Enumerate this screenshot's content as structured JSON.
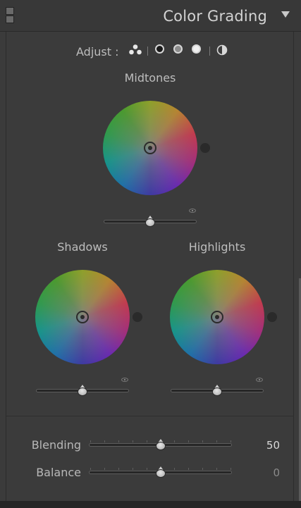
{
  "panel": {
    "title": "Color Grading",
    "icons": [
      "collapse-square-icon",
      "panel-menu-triangle-icon"
    ]
  },
  "adjust": {
    "label": "Adjust :",
    "modes": [
      "three-way",
      "shadows",
      "midtones",
      "highlights",
      "global"
    ],
    "selected": "three-way",
    "colors": {
      "shadows": "#1a1a1a",
      "midtones": "#8c8c8c",
      "highlights": "#f0f0f0"
    }
  },
  "wheels": {
    "midtones": {
      "label": "Midtones",
      "luminance": 0.5
    },
    "shadows": {
      "label": "Shadows",
      "luminance": 0.5
    },
    "highlights": {
      "label": "Highlights",
      "luminance": 0.5
    }
  },
  "blending": {
    "label": "Blending",
    "value": "50",
    "value_color": "#d8d8d8",
    "position": 0.5
  },
  "balance": {
    "label": "Balance",
    "value": "0",
    "value_color": "#8a8a8a",
    "position": 0.5
  },
  "colors": {
    "panel_bg": "#3b3b3b",
    "track": "#262626",
    "text": "#bdbdbd"
  }
}
